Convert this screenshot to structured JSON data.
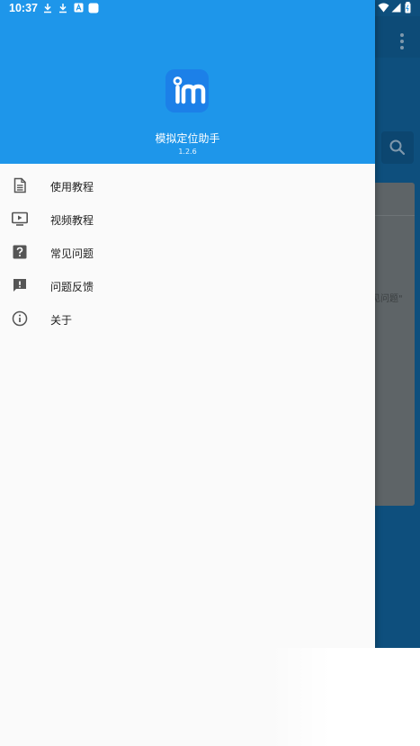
{
  "status_bar": {
    "time": "10:37"
  },
  "drawer": {
    "app_name": "模拟定位助手",
    "version": "1.2.6",
    "items": [
      {
        "label": "使用教程",
        "icon": "document-icon"
      },
      {
        "label": "视频教程",
        "icon": "video-icon"
      },
      {
        "label": "常见问题",
        "icon": "help-icon"
      },
      {
        "label": "问题反馈",
        "icon": "feedback-icon"
      },
      {
        "label": "关于",
        "icon": "info-icon"
      }
    ]
  },
  "background": {
    "card_text": "见问题\""
  },
  "colors": {
    "header_blue": "#1e96ea",
    "logo_blue": "#1c80e8",
    "dim_overlay": "#0e4f7d"
  }
}
